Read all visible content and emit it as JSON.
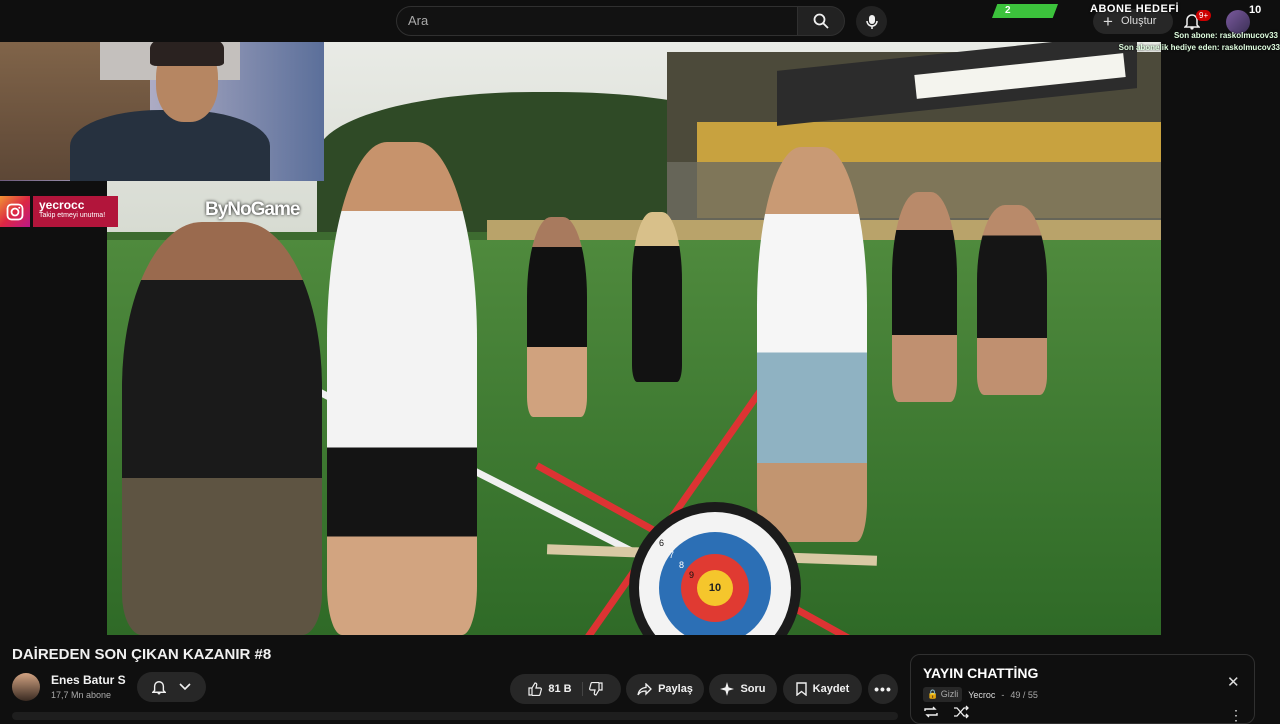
{
  "search": {
    "placeholder": "Ara"
  },
  "header": {
    "create_label": "Oluştur",
    "notif_badge": "9+"
  },
  "overlay": {
    "goal_current": "2",
    "goal_title": "ABONE HEDEFİ",
    "goal_target": "10",
    "last_sub": "Son abone: raskolmucov33",
    "last_gift": "Son abonelik hediye eden: raskolmucov33"
  },
  "instagram": {
    "handle": "yecrocc",
    "tagline": "Takip etmeyi unutma!"
  },
  "video_watermark": "ByNoGame",
  "target_label": "10",
  "target_numbers": [
    "6",
    "7",
    "8",
    "9"
  ],
  "video": {
    "title": "DAİREDEN SON ÇIKAN KAZANIR #8",
    "channel": "Enes Batur S",
    "subscribers": "17,7 Mn abone",
    "likes": "81 B",
    "share_label": "Paylaş",
    "ask_label": "Soru",
    "save_label": "Kaydet"
  },
  "chat": {
    "title": "YAYIN CHATTİNG",
    "visibility": "Gizli",
    "owner": "Yecroc",
    "count": "49 / 55"
  },
  "colors": {
    "accent_red": "#cc0000",
    "goal_green": "#3cc23c",
    "instagram_pink": "#b2153b"
  }
}
